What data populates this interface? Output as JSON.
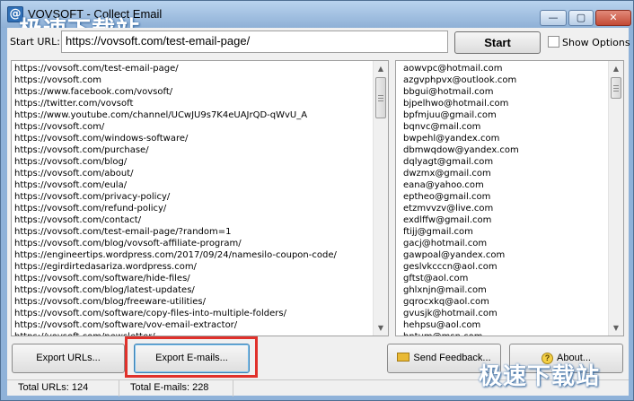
{
  "window": {
    "title": "VOVSOFT - Collect Email",
    "watermark": "极速下载站",
    "buttons": {
      "minimize": "—",
      "maximize": "▢",
      "close": "✕"
    }
  },
  "toolbar": {
    "url_label": "Start URL:",
    "url_value": "https://vovsoft.com/test-email-page/",
    "start_label": "Start",
    "show_options_label": "Show Options",
    "show_options_checked": false
  },
  "urls": [
    "https://vovsoft.com/test-email-page/",
    "https://vovsoft.com",
    "https://www.facebook.com/vovsoft/",
    "https://twitter.com/vovsoft",
    "https://www.youtube.com/channel/UCwJU9s7K4eUAJrQD-qWvU_A",
    "https://vovsoft.com/",
    "https://vovsoft.com/windows-software/",
    "https://vovsoft.com/purchase/",
    "https://vovsoft.com/blog/",
    "https://vovsoft.com/about/",
    "https://vovsoft.com/eula/",
    "https://vovsoft.com/privacy-policy/",
    "https://vovsoft.com/refund-policy/",
    "https://vovsoft.com/contact/",
    "https://vovsoft.com/test-email-page/?random=1",
    "https://vovsoft.com/blog/vovsoft-affiliate-program/",
    "https://engineertips.wordpress.com/2017/09/24/namesilo-coupon-code/",
    "https://egirdirtedasariza.wordpress.com/",
    "https://vovsoft.com/software/hide-files/",
    "https://vovsoft.com/blog/latest-updates/",
    "https://vovsoft.com/blog/freeware-utilities/",
    "https://vovsoft.com/software/copy-files-into-multiple-folders/",
    "https://vovsoft.com/software/vov-email-extractor/",
    "https://vovsoft.com/newsletter/"
  ],
  "emails": [
    "aowvpc@hotmail.com",
    "azgvphpvx@outlook.com",
    "bbgui@hotmail.com",
    "bjpelhwo@hotmail.com",
    "bpfmjuu@gmail.com",
    "bqnvc@mail.com",
    "bwpehl@yandex.com",
    "dbmwqdow@yandex.com",
    "dqlyagt@gmail.com",
    "dwzmx@gmail.com",
    "eana@yahoo.com",
    "eptheo@gmail.com",
    "etzmvvzv@live.com",
    "exdlffw@gmail.com",
    "ftijj@gmail.com",
    "gacj@hotmail.com",
    "gawpoal@yandex.com",
    "geslvkcccn@aol.com",
    "gftst@aol.com",
    "ghlxnjn@mail.com",
    "gqrocxkq@aol.com",
    "gvusjk@hotmail.com",
    "hehpsu@aol.com",
    "hntum@msn.com"
  ],
  "actions": {
    "export_urls": "Export URLs...",
    "export_emails": "Export E-mails...",
    "send_feedback": "Send Feedback...",
    "about": "About..."
  },
  "status": {
    "total_urls": "Total URLs: 124",
    "total_emails": "Total E-mails: 228"
  },
  "icons": {
    "app": "at-sign-icon",
    "feedback": "envelope-icon",
    "about": "help-icon"
  },
  "colors": {
    "title_bar": "#8fb2d9",
    "highlight": "#e0312b"
  }
}
